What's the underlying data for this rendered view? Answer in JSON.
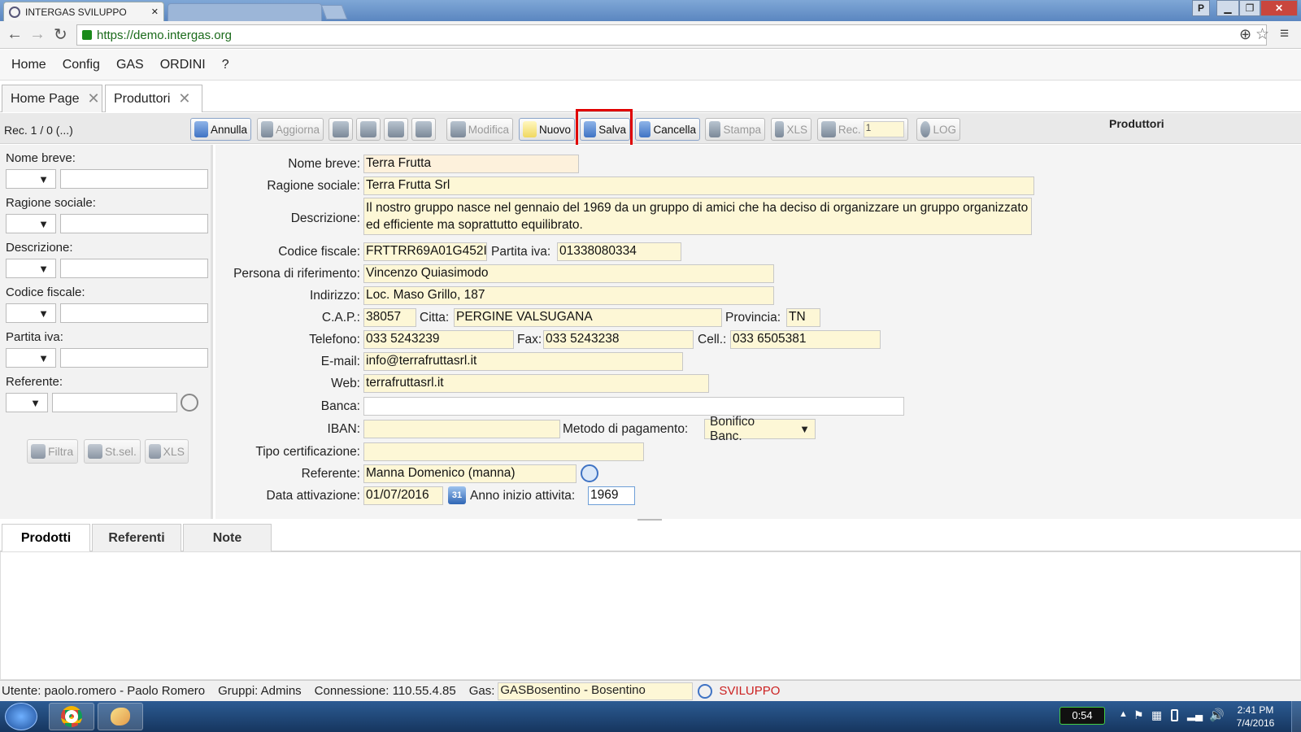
{
  "browser": {
    "tab_title": "INTERGAS SVILUPPO",
    "tab_close": "✕",
    "url": "https://demo.intergas.org",
    "colors": {
      "titlebar": "#5b86c0",
      "url_green": "#1a8a1a"
    }
  },
  "menu": {
    "items": [
      "Home",
      "Config",
      "GAS",
      "ORDINI",
      "?"
    ]
  },
  "tabs": {
    "items": [
      {
        "label": "Home Page",
        "close": "✕"
      },
      {
        "label": "Produttori",
        "close": "✕"
      }
    ],
    "active": "Produttori"
  },
  "toolbar": {
    "record_info": "Rec. 1 / 0 (...)",
    "section_title": "Produttori",
    "buttons": {
      "annulla": "Annulla",
      "aggiorna": "Aggiorna",
      "modifica": "Modifica",
      "nuovo": "Nuovo",
      "salva": "Salva",
      "cancella": "Cancella",
      "stampa": "Stampa",
      "xls": "XLS",
      "rec": "Rec.",
      "log": "LOG"
    },
    "rec_value": "1",
    "highlight_color": "#e00000"
  },
  "filters": {
    "labels": [
      "Nome breve:",
      "Ragione sociale:",
      "Descrizione:",
      "Codice fiscale:",
      "Partita iva:",
      "Referente:"
    ],
    "dropdown_arrow": "▼",
    "buttons": {
      "filtra": "Filtra",
      "stsel": "St.sel.",
      "xls": "XLS"
    }
  },
  "form": {
    "labels": {
      "nome_breve": "Nome breve:",
      "ragione_sociale": "Ragione sociale:",
      "descrizione": "Descrizione:",
      "codice_fiscale": "Codice fiscale:",
      "partita_iva": "Partita iva:",
      "persona_riferimento": "Persona di riferimento:",
      "indirizzo": "Indirizzo:",
      "cap": "C.A.P.:",
      "citta": "Citta:",
      "provincia": "Provincia:",
      "telefono": "Telefono:",
      "fax": "Fax:",
      "cell": "Cell.:",
      "email": "E-mail:",
      "web": "Web:",
      "banca": "Banca:",
      "iban": "IBAN:",
      "metodo_pagamento": "Metodo di pagamento:",
      "tipo_certificazione": "Tipo certificazione:",
      "referente": "Referente:",
      "data_attivazione": "Data attivazione:",
      "anno_inizio": "Anno inizio attivita:"
    },
    "values": {
      "nome_breve": "Terra Frutta",
      "ragione_sociale": "Terra Frutta Srl",
      "descrizione": "Il nostro gruppo nasce nel gennaio del 1969 da un gruppo di amici che ha deciso di organizzare un gruppo organizzato ed efficiente ma soprattutto equilibrato.",
      "codice_fiscale": "FRTTRR69A01G452I",
      "partita_iva": "01338080334",
      "persona_riferimento": "Vincenzo Quiasimodo",
      "indirizzo": "Loc. Maso Grillo, 187",
      "cap": "38057",
      "citta": "PERGINE VALSUGANA",
      "provincia": "TN",
      "telefono": "033 5243239",
      "fax": "033 5243238",
      "cell": "033 6505381",
      "email": "info@terrafruttasrl.it",
      "web": "terrafruttasrl.it",
      "banca": "",
      "iban": "",
      "metodo_pagamento": "Bonifico Banc.",
      "tipo_certificazione": "",
      "referente": "Manna Domenico (manna)",
      "data_attivazione": "01/07/2016",
      "calendar_day": "31",
      "anno_inizio": "1969"
    },
    "field_color": "#fdf7d6"
  },
  "bottom_tabs": {
    "items": [
      "Prodotti",
      "Referenti",
      "Note"
    ],
    "active": "Prodotti"
  },
  "status": {
    "utente": "Utente: paolo.romero - Paolo Romero",
    "gruppi": "Gruppi: Admins",
    "connessione": "Connessione: 110.55.4.85",
    "gas_label": "Gas:",
    "gas_value": "GASBosentino - Bosentino",
    "env": "SVILUPPO",
    "env_color": "#cc2222"
  },
  "taskbar": {
    "battery": "0:54",
    "time": "2:41 PM",
    "date": "7/4/2016"
  }
}
